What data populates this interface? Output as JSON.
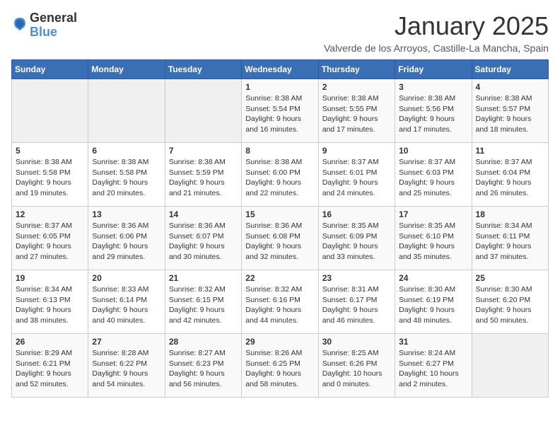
{
  "logo": {
    "line1": "General",
    "line2": "Blue"
  },
  "title": "January 2025",
  "subtitle": "Valverde de los Arroyos, Castille-La Mancha, Spain",
  "weekdays": [
    "Sunday",
    "Monday",
    "Tuesday",
    "Wednesday",
    "Thursday",
    "Friday",
    "Saturday"
  ],
  "weeks": [
    [
      {
        "day": "",
        "info": ""
      },
      {
        "day": "",
        "info": ""
      },
      {
        "day": "",
        "info": ""
      },
      {
        "day": "1",
        "info": "Sunrise: 8:38 AM\nSunset: 5:54 PM\nDaylight: 9 hours\nand 16 minutes."
      },
      {
        "day": "2",
        "info": "Sunrise: 8:38 AM\nSunset: 5:55 PM\nDaylight: 9 hours\nand 17 minutes."
      },
      {
        "day": "3",
        "info": "Sunrise: 8:38 AM\nSunset: 5:56 PM\nDaylight: 9 hours\nand 17 minutes."
      },
      {
        "day": "4",
        "info": "Sunrise: 8:38 AM\nSunset: 5:57 PM\nDaylight: 9 hours\nand 18 minutes."
      }
    ],
    [
      {
        "day": "5",
        "info": "Sunrise: 8:38 AM\nSunset: 5:58 PM\nDaylight: 9 hours\nand 19 minutes."
      },
      {
        "day": "6",
        "info": "Sunrise: 8:38 AM\nSunset: 5:58 PM\nDaylight: 9 hours\nand 20 minutes."
      },
      {
        "day": "7",
        "info": "Sunrise: 8:38 AM\nSunset: 5:59 PM\nDaylight: 9 hours\nand 21 minutes."
      },
      {
        "day": "8",
        "info": "Sunrise: 8:38 AM\nSunset: 6:00 PM\nDaylight: 9 hours\nand 22 minutes."
      },
      {
        "day": "9",
        "info": "Sunrise: 8:37 AM\nSunset: 6:01 PM\nDaylight: 9 hours\nand 24 minutes."
      },
      {
        "day": "10",
        "info": "Sunrise: 8:37 AM\nSunset: 6:03 PM\nDaylight: 9 hours\nand 25 minutes."
      },
      {
        "day": "11",
        "info": "Sunrise: 8:37 AM\nSunset: 6:04 PM\nDaylight: 9 hours\nand 26 minutes."
      }
    ],
    [
      {
        "day": "12",
        "info": "Sunrise: 8:37 AM\nSunset: 6:05 PM\nDaylight: 9 hours\nand 27 minutes."
      },
      {
        "day": "13",
        "info": "Sunrise: 8:36 AM\nSunset: 6:06 PM\nDaylight: 9 hours\nand 29 minutes."
      },
      {
        "day": "14",
        "info": "Sunrise: 8:36 AM\nSunset: 6:07 PM\nDaylight: 9 hours\nand 30 minutes."
      },
      {
        "day": "15",
        "info": "Sunrise: 8:36 AM\nSunset: 6:08 PM\nDaylight: 9 hours\nand 32 minutes."
      },
      {
        "day": "16",
        "info": "Sunrise: 8:35 AM\nSunset: 6:09 PM\nDaylight: 9 hours\nand 33 minutes."
      },
      {
        "day": "17",
        "info": "Sunrise: 8:35 AM\nSunset: 6:10 PM\nDaylight: 9 hours\nand 35 minutes."
      },
      {
        "day": "18",
        "info": "Sunrise: 8:34 AM\nSunset: 6:11 PM\nDaylight: 9 hours\nand 37 minutes."
      }
    ],
    [
      {
        "day": "19",
        "info": "Sunrise: 8:34 AM\nSunset: 6:13 PM\nDaylight: 9 hours\nand 38 minutes."
      },
      {
        "day": "20",
        "info": "Sunrise: 8:33 AM\nSunset: 6:14 PM\nDaylight: 9 hours\nand 40 minutes."
      },
      {
        "day": "21",
        "info": "Sunrise: 8:32 AM\nSunset: 6:15 PM\nDaylight: 9 hours\nand 42 minutes."
      },
      {
        "day": "22",
        "info": "Sunrise: 8:32 AM\nSunset: 6:16 PM\nDaylight: 9 hours\nand 44 minutes."
      },
      {
        "day": "23",
        "info": "Sunrise: 8:31 AM\nSunset: 6:17 PM\nDaylight: 9 hours\nand 46 minutes."
      },
      {
        "day": "24",
        "info": "Sunrise: 8:30 AM\nSunset: 6:19 PM\nDaylight: 9 hours\nand 48 minutes."
      },
      {
        "day": "25",
        "info": "Sunrise: 8:30 AM\nSunset: 6:20 PM\nDaylight: 9 hours\nand 50 minutes."
      }
    ],
    [
      {
        "day": "26",
        "info": "Sunrise: 8:29 AM\nSunset: 6:21 PM\nDaylight: 9 hours\nand 52 minutes."
      },
      {
        "day": "27",
        "info": "Sunrise: 8:28 AM\nSunset: 6:22 PM\nDaylight: 9 hours\nand 54 minutes."
      },
      {
        "day": "28",
        "info": "Sunrise: 8:27 AM\nSunset: 6:23 PM\nDaylight: 9 hours\nand 56 minutes."
      },
      {
        "day": "29",
        "info": "Sunrise: 8:26 AM\nSunset: 6:25 PM\nDaylight: 9 hours\nand 58 minutes."
      },
      {
        "day": "30",
        "info": "Sunrise: 8:25 AM\nSunset: 6:26 PM\nDaylight: 10 hours\nand 0 minutes."
      },
      {
        "day": "31",
        "info": "Sunrise: 8:24 AM\nSunset: 6:27 PM\nDaylight: 10 hours\nand 2 minutes."
      },
      {
        "day": "",
        "info": ""
      }
    ]
  ]
}
